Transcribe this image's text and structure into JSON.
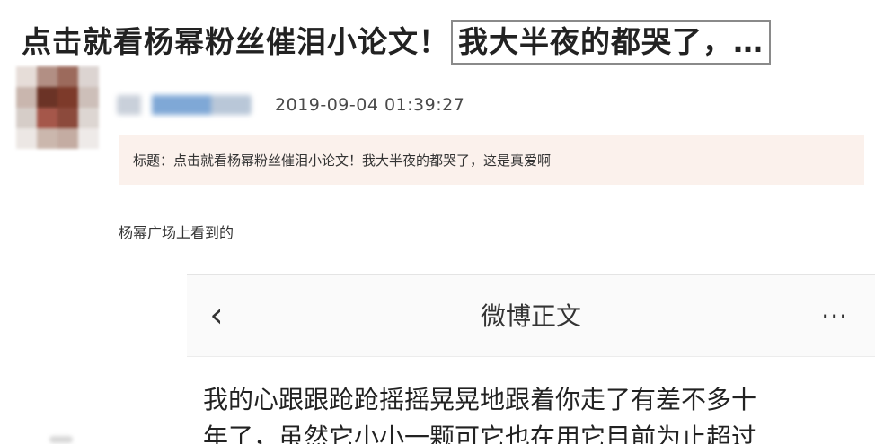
{
  "post": {
    "title_main": "点击就看杨幂粉丝催泪小论文！",
    "title_highlight": "我大半夜的都哭了，…"
  },
  "user": {
    "avatar_colors": [
      "#e6ddd8",
      "#b28f84",
      "#9c6a5c",
      "#dcd4d1",
      "#c9b6ae",
      "#6b3326",
      "#7d3a2a",
      "#cdbfb9",
      "#d6cdc8",
      "#a5574a",
      "#8c4a3c",
      "#ddd6d2",
      "#ece7e4",
      "#cbb7ad",
      "#c4aca2",
      "#eeeae8"
    ],
    "timestamp": "2019-09-04 01:39:27"
  },
  "thread": {
    "title_line": "标题：点击就看杨幂粉丝催泪小论文！我大半夜的都哭了，这是真爱啊",
    "body": "杨幂广场上看到的"
  },
  "embedded_screenshot": {
    "nav_title": "微博正文",
    "back_icon": "‹",
    "more_icon": "···",
    "text_line_1": "我的心跟跟跄跄摇摇晃晃地跟着你走了有差不多十",
    "text_line_2": "年了，虽然它小小一颗可它也在用它目前为止超过"
  }
}
